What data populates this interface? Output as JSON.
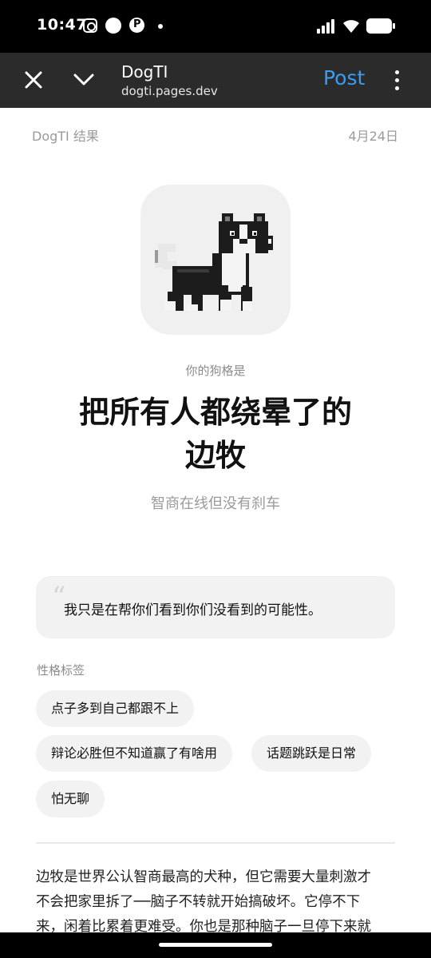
{
  "status_bar": {
    "time": "10:47",
    "icons": [
      "instagram-icon",
      "circle-icon",
      "p-icon",
      "dot-icon",
      "signal-icon",
      "wifi-icon",
      "battery-icon"
    ]
  },
  "toolbar": {
    "site_name": "DogTI",
    "url": "dogti.pages.dev",
    "post_label": "Post",
    "post_color": "#3b9cf0",
    "icons": [
      "close-icon",
      "chevron-down-icon",
      "more-vert-icon"
    ]
  },
  "page": {
    "meta_left": "DogTI 结果",
    "meta_right": "4月24日",
    "avatar": "pixel-dog-icon",
    "result_label": "你的狗格是",
    "headline_line1": "把所有人都绕晕了的",
    "headline_line2": "边牧",
    "subtitle": "智商在线但没有刹车",
    "quote": "我只是在帮你们看到你们没看到的可能性。",
    "tags_title": "性格标签",
    "tags": [
      "点子多到自己都跟不上",
      "辩论必胜但不知道赢了有啥用",
      "话题跳跃是日常",
      "怕无聊"
    ],
    "body_lines": [
      "边牧是世界公认智商最高的犬种，但它需要大量刺激才",
      "不会把家里拆了──脑子不转就开始搞破坏。它停不下",
      "来，闲着比累着更难受。你也是那种脑子一旦停下来就"
    ]
  }
}
